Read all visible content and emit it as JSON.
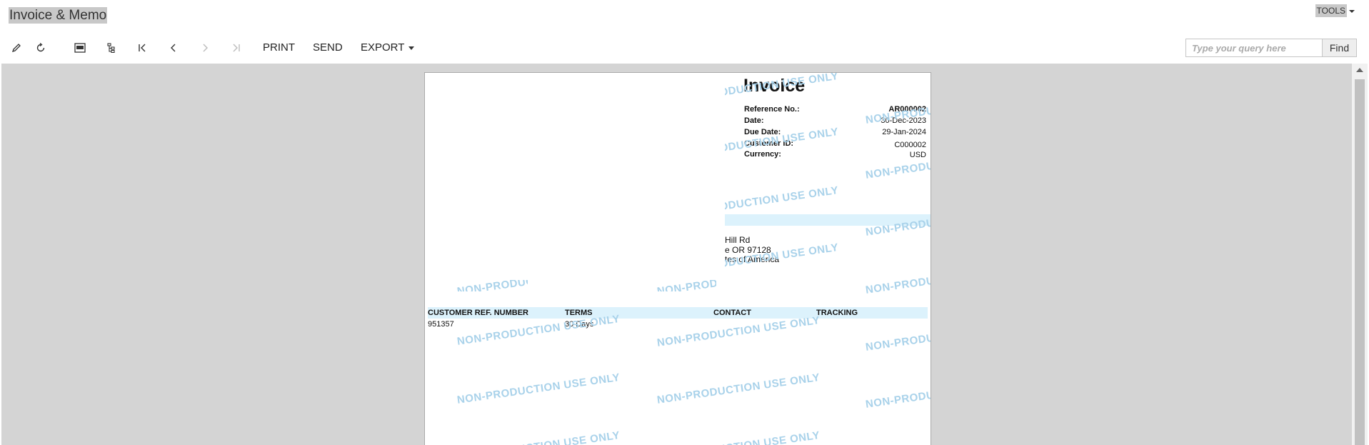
{
  "header": {
    "title": "Invoice & Memo",
    "tools_label": "TOOLS"
  },
  "toolbar": {
    "icons": [
      "edit-icon",
      "refresh-icon",
      "pdf-icon",
      "tree-icon",
      "first-page-icon",
      "prev-page-icon",
      "next-page-icon",
      "last-page-icon"
    ],
    "print_label": "PRINT",
    "send_label": "SEND",
    "export_label": "EXPORT"
  },
  "search": {
    "placeholder": "Type your query here",
    "button": "Find"
  },
  "invoice": {
    "title": "Invoice",
    "fields": [
      {
        "label": "Reference No.:",
        "value": "AR000002"
      },
      {
        "label": "Date:",
        "value": "30-Dec-2023"
      },
      {
        "label": "Due Date:",
        "value": "29-Jan-2024"
      },
      {
        "label": "Customer ID:",
        "value": "C000002"
      },
      {
        "label": "Currency:",
        "value": "USD"
      }
    ],
    "address_lines": [
      "Hill Rd",
      "e OR 97128",
      "tes of America"
    ],
    "table_headers": [
      "CUSTOMER REF. NUMBER",
      "TERMS",
      "CONTACT",
      "TRACKING"
    ],
    "table_row": [
      "951357",
      "30 Days",
      "",
      ""
    ],
    "watermark": "NON-PRODUCTION USE ONLY"
  },
  "colors": {
    "viewer_bg": "#d4d4d4",
    "band": "#dcf2fc",
    "watermark": "#a9d2ea"
  }
}
